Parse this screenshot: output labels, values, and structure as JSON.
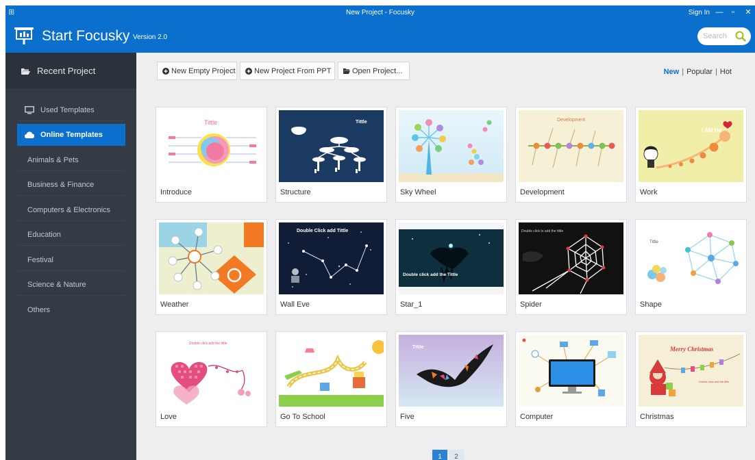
{
  "window": {
    "title": "New Project - Focusky",
    "sign_in": "Sign In",
    "app_icon": "presentation-icon"
  },
  "header": {
    "brand": "Start Focusky",
    "version": "Version 2.0",
    "search_placeholder": "Search"
  },
  "sidebar": {
    "recent_label": "Recent Project",
    "items": [
      {
        "label": "Used Templates",
        "icon": "monitor-icon"
      },
      {
        "label": "Online Templates",
        "icon": "cloud-icon",
        "active": true
      },
      {
        "label": "Animals & Pets"
      },
      {
        "label": "Business & Finance"
      },
      {
        "label": "Computers & Electronics"
      },
      {
        "label": "Education"
      },
      {
        "label": "Festival"
      },
      {
        "label": "Science & Nature"
      },
      {
        "label": "Others"
      }
    ]
  },
  "toolbar": {
    "new_empty": "New Empty Project",
    "new_ppt": "New Project From PPT",
    "open_project": "Open Project..."
  },
  "sort": {
    "options": [
      "New",
      "Popular",
      "Hot"
    ],
    "selected": "New",
    "separator": "|"
  },
  "templates": [
    {
      "name": "Introduce"
    },
    {
      "name": "Structure"
    },
    {
      "name": "Sky Wheel"
    },
    {
      "name": "Development"
    },
    {
      "name": "Work"
    },
    {
      "name": "Weather"
    },
    {
      "name": "Wall Eve"
    },
    {
      "name": "Star_1"
    },
    {
      "name": "Spider"
    },
    {
      "name": "Shape"
    },
    {
      "name": "Love"
    },
    {
      "name": "Go To School"
    },
    {
      "name": "Five"
    },
    {
      "name": "Computer"
    },
    {
      "name": "Christmas"
    }
  ],
  "thumb_text": {
    "introduce_title": "Tittle",
    "structure_title": "Tittle",
    "development_title": "Development",
    "work_text": "I AM Ha",
    "walleve_text": "Double Click add Tittle",
    "star_text": "Double click add the Tittle",
    "spider_text": "Double click to add the tittle",
    "shape_title": "Tittle",
    "love_text": "Double click add the tittle",
    "five_title": "Tittle",
    "christmas_title": "Merry Christmas",
    "christmas_sub": "Double click add the tittle"
  },
  "pagination": {
    "pages": [
      "1",
      "2"
    ],
    "current": "1"
  },
  "colors": {
    "accent": "#0a6fcd",
    "sidebar_bg": "#343b45",
    "content_bg": "#eeeef0"
  }
}
